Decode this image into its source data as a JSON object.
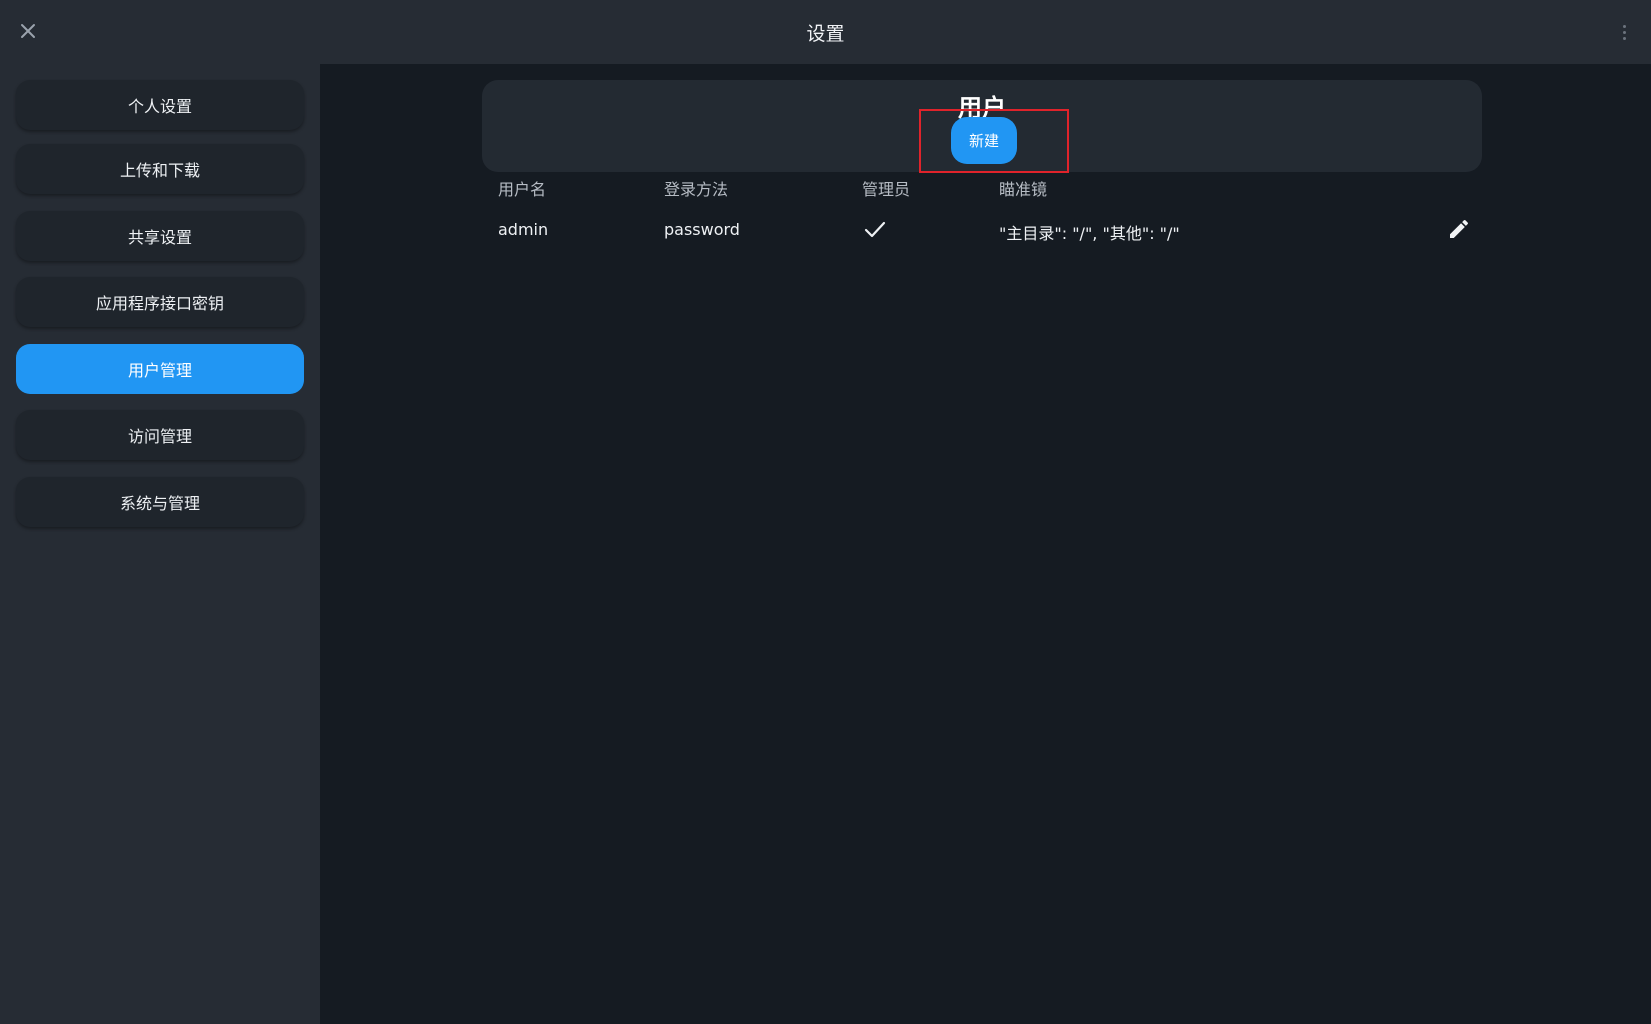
{
  "window": {
    "title": "设置"
  },
  "sidebar": {
    "items": [
      {
        "label": "个人设置"
      },
      {
        "label": "上传和下载"
      },
      {
        "label": "共享设置"
      },
      {
        "label": "应用程序接口密钥"
      },
      {
        "label": "用户管理",
        "active": true
      },
      {
        "label": "访问管理"
      },
      {
        "label": "系统与管理"
      }
    ]
  },
  "users_section": {
    "title": "用户",
    "new_button": "新建",
    "columns": [
      "用户名",
      "登录方法",
      "管理员",
      "瞄准镜"
    ],
    "rows": [
      {
        "username": "admin",
        "login_method": "password",
        "admin": true,
        "scope": "\"主目录\": \"/\", \"其他\": \"/\""
      }
    ]
  },
  "colors": {
    "accent": "#2196f3",
    "highlight_box": "#e0232b"
  },
  "icons": [
    "close-icon",
    "kebab-menu-icon",
    "checkmark-icon",
    "edit-pencil-icon"
  ]
}
